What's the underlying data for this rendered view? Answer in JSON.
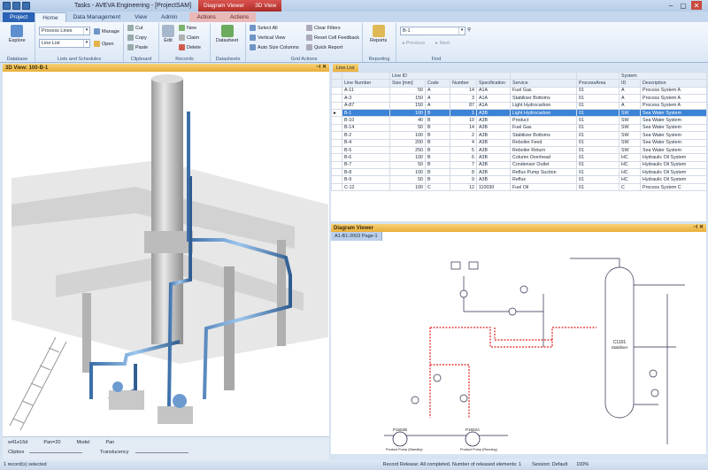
{
  "titlebar": {
    "text": "Tasks - AVEVA Engineering - [ProjectSAM]",
    "ctx1": "Diagram Viewer",
    "ctx2": "3D View",
    "min": "–",
    "max": "▢",
    "close": "✕"
  },
  "tabs": [
    "Project",
    "Home",
    "Data Management",
    "View",
    "Admin",
    "Actions",
    "Actions"
  ],
  "ribbon": {
    "database": {
      "explore": "Explore",
      "label": "Database"
    },
    "lists": {
      "combo1": "Process Lines",
      "combo2": "Line List",
      "manage": "Manage",
      "open": "Open",
      "label": "Lists and Schedules"
    },
    "clipboard": {
      "cut": "Cut",
      "copy": "Copy",
      "paste": "Paste",
      "label": "Clipboard"
    },
    "records": {
      "edit": "Edit",
      "new": "New",
      "claim": "Claim",
      "delete": "Delete",
      "label": "Records"
    },
    "datasheets": {
      "datasheet": "Datasheet",
      "label": "Datasheets"
    },
    "grid": {
      "select_all": "Select All",
      "vertical": "Vertical View",
      "autosize": "Auto Size Columns",
      "clear": "Clear Filters",
      "reset": "Reset Cell Feedback",
      "quick": "Quick Report",
      "label": "Grid Actions"
    },
    "reporting": {
      "reports": "Reports",
      "label": "Reporting"
    },
    "find": {
      "value": "B-1",
      "previous": "Previous",
      "next": "Next",
      "label": "Find"
    }
  },
  "view3d": {
    "title": "3D View: 100-B-1",
    "status": [
      "w41e16d",
      "Pan=20",
      "Model",
      "Pan"
    ],
    "clipbox": "Clipbox",
    "translucency": "Translucency"
  },
  "grid": {
    "tab": "Line List",
    "group1": "Line ID",
    "group2": "System",
    "headers": [
      "Line Number",
      "Size [mm]",
      "Code",
      "Number",
      "Specification",
      "Service",
      "ProcessArea",
      "ID",
      "Description"
    ],
    "rows": [
      [
        "A-11",
        "50",
        "A",
        "14",
        "A1A",
        "Fuel Gas",
        "01",
        "A",
        "Process System A"
      ],
      [
        "A-3",
        "150",
        "A",
        "3",
        "A1A",
        "Stabiliser Bottoms",
        "01",
        "A",
        "Process System A"
      ],
      [
        "A-87",
        "150",
        "A",
        "87",
        "A1A",
        "Light Hydrocarbon",
        "01",
        "A",
        "Process System A"
      ],
      [
        "B-1",
        "100",
        "B",
        "1",
        "A3B",
        "Light Hydrocarbon",
        "01",
        "SW",
        "Sea Water System"
      ],
      [
        "B-10",
        "40",
        "B",
        "10",
        "A3B",
        "Product",
        "01",
        "SW",
        "Sea Water System"
      ],
      [
        "B-14",
        "50",
        "B",
        "14",
        "A3B",
        "Fuel Gas",
        "01",
        "SW",
        "Sea Water System"
      ],
      [
        "B-2",
        "100",
        "B",
        "2",
        "A3B",
        "Stabilizer Bottoms",
        "01",
        "SW",
        "Sea Water System"
      ],
      [
        "B-4",
        "200",
        "B",
        "4",
        "A3B",
        "Reboiler Feed",
        "01",
        "SW",
        "Sea Water System"
      ],
      [
        "B-5",
        "250",
        "B",
        "5",
        "A3B",
        "Reboiler Return",
        "01",
        "SW",
        "Sea Water System"
      ],
      [
        "B-6",
        "100",
        "B",
        "6",
        "A3B",
        "Column Overhead",
        "01",
        "HC",
        "Hydraulic Oil System"
      ],
      [
        "B-7",
        "50",
        "B",
        "7",
        "A3B",
        "Condensor Outlet",
        "01",
        "HC",
        "Hydraulic Oil System"
      ],
      [
        "B-8",
        "100",
        "B",
        "8",
        "A3B",
        "Reflux Pump Suction",
        "01",
        "HC",
        "Hydraulic Oil System"
      ],
      [
        "B-9",
        "50",
        "B",
        "9",
        "A3B",
        "Reflux",
        "01",
        "HC",
        "Hydraulic Oil System"
      ],
      [
        "C-12",
        "100",
        "C",
        "12",
        "110030",
        "Fuel Oil",
        "01",
        "C",
        "Process System C"
      ]
    ]
  },
  "diagram": {
    "title": "Diagram Viewer",
    "tab": "A1-B1-2003 Page-1",
    "column": "C1101",
    "column_sub": "Stabiliser",
    "pump1": "P1502B",
    "pump1_sub": "Product Pump (Standby)",
    "pump2": "P1502A",
    "pump2_sub": "Product Pump (Running)"
  },
  "statusbar": {
    "left": "1 record(s) selected",
    "middle": "Record Release: All completed. Number of released elements: 1",
    "right": "Session: Default",
    "zoom": "100%"
  }
}
